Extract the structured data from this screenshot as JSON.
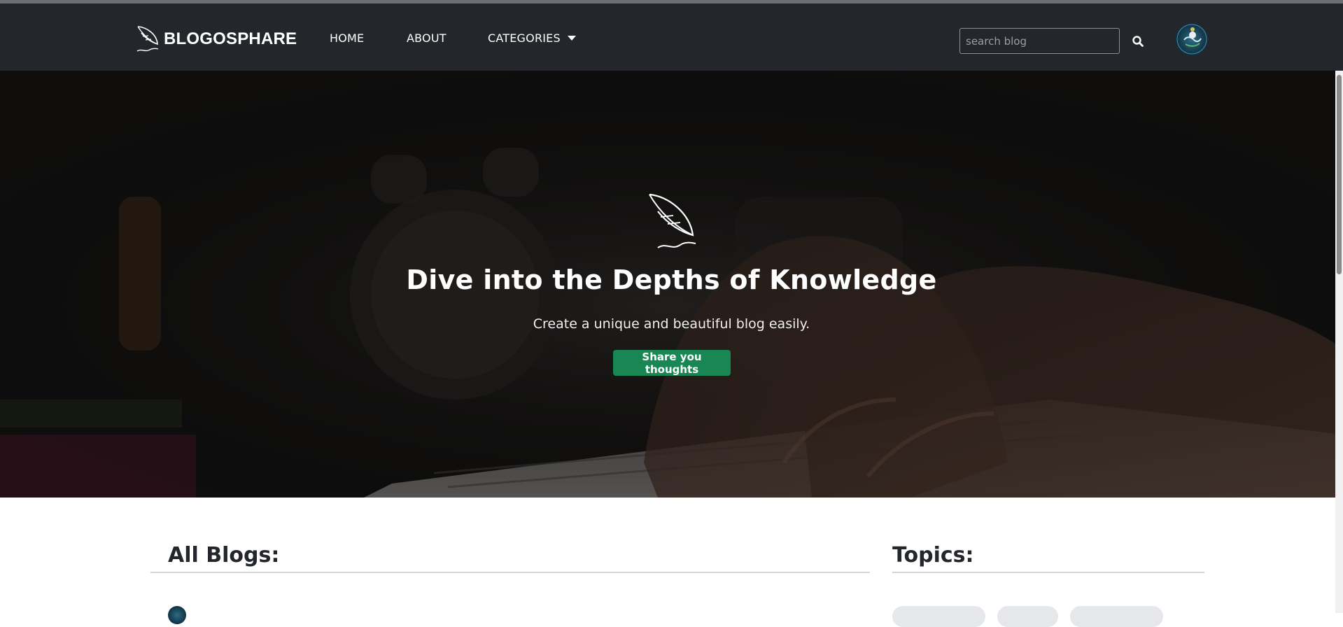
{
  "navbar": {
    "brand": "BLOGOSPHARE",
    "links": {
      "home": "HOME",
      "about": "ABOUT",
      "categories": "CATEGORIES"
    },
    "search": {
      "placeholder": "search blog",
      "value": ""
    }
  },
  "hero": {
    "title": "Dive into the Depths of Knowledge",
    "subtitle": "Create a unique and beautiful blog easily.",
    "cta_label": "Share you thoughts"
  },
  "main": {
    "blogs_heading": "All Blogs:",
    "topics_heading": "Topics:"
  },
  "colors": {
    "navbar_bg": "#23262b",
    "cta_green": "#198754",
    "heading_text": "#23262b",
    "divider": "#d4d6d9"
  },
  "icons": {
    "brand": "feather-quill-icon",
    "search": "search-icon",
    "dropdown": "caret-down-icon",
    "hero": "feather-quill-icon"
  }
}
